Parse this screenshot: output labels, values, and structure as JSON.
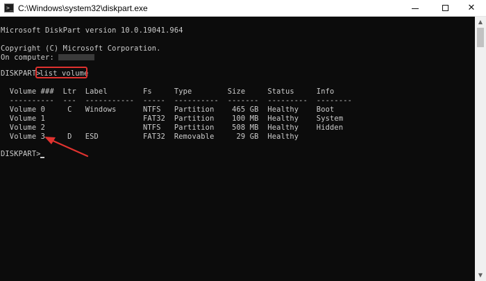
{
  "window": {
    "title": "C:\\Windows\\system32\\diskpart.exe",
    "close_glyph": "✕",
    "icon": "cmd-prompt-icon"
  },
  "console": {
    "version_line": "Microsoft DiskPart version 10.0.19041.964",
    "copyright_line": "Copyright (C) Microsoft Corporation.",
    "computer_line": "On computer:",
    "prompt": "DISKPART> ",
    "command": "list volume",
    "header_line": "  Volume ###  Ltr  Label        Fs     Type        Size     Status     Info",
    "separator_line": "  ----------  ---  -----------  -----  ----------  -------  ---------  --------",
    "rows": [
      "  Volume 0     C   Windows      NTFS   Partition    465 GB  Healthy    Boot",
      "  Volume 1                      FAT32  Partition    100 MB  Healthy    System",
      "  Volume 2                      NTFS   Partition    508 MB  Healthy    Hidden",
      "  Volume 3     D   ESD          FAT32  Removable     29 GB  Healthy"
    ],
    "final_prompt": "DISKPART> "
  },
  "colors": {
    "background": "#0c0c0c",
    "text": "#cccccc",
    "annotation": "#e0322f"
  }
}
